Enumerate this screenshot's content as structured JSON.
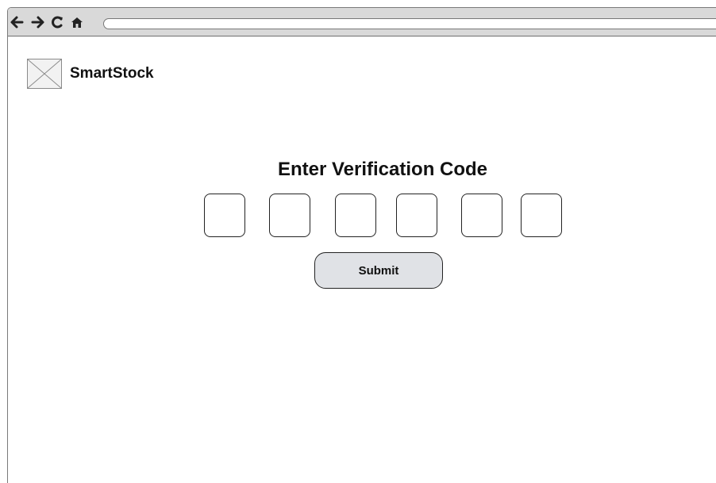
{
  "browser": {
    "icons": [
      "back-arrow-icon",
      "forward-arrow-icon",
      "reload-icon",
      "home-icon"
    ],
    "address_value": ""
  },
  "header": {
    "logo_icon": "image-placeholder-icon",
    "brand_name": "SmartStock"
  },
  "verification": {
    "title": "Enter Verification Code",
    "code_inputs": [
      {
        "value": ""
      },
      {
        "value": ""
      },
      {
        "value": ""
      },
      {
        "value": ""
      },
      {
        "value": ""
      },
      {
        "value": ""
      }
    ],
    "submit_label": "Submit"
  },
  "colors": {
    "browser_bar": "#d9d9d9",
    "border": "#222222",
    "submit_background": "#e0e2e6",
    "text": "#111111"
  }
}
